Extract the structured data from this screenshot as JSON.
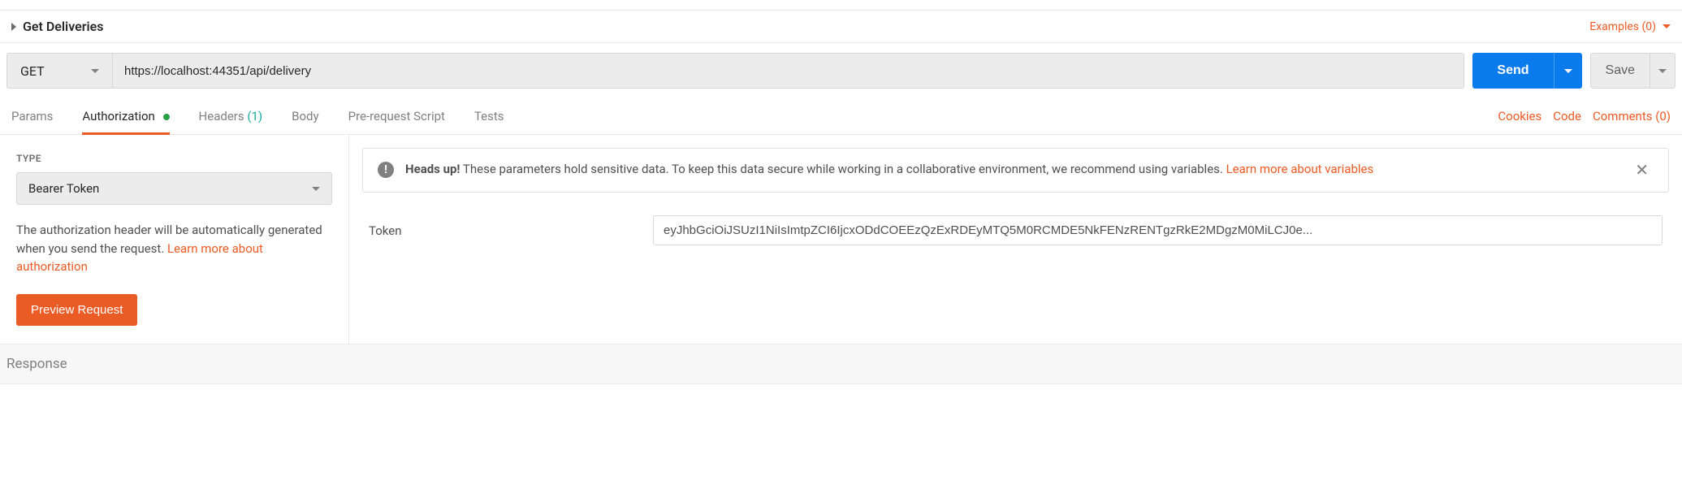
{
  "request": {
    "name": "Get Deliveries",
    "examples_label": "Examples (0)",
    "method": "GET",
    "url": "https://localhost:44351/api/delivery",
    "send_label": "Send",
    "save_label": "Save"
  },
  "tabs": {
    "params": "Params",
    "authorization": "Authorization",
    "headers": "Headers",
    "headers_count": "(1)",
    "body": "Body",
    "prerequest": "Pre-request Script",
    "tests": "Tests"
  },
  "right_links": {
    "cookies": "Cookies",
    "code": "Code",
    "comments": "Comments (0)"
  },
  "auth": {
    "type_heading": "TYPE",
    "type_value": "Bearer Token",
    "description": "The authorization header will be automatically generated when you send the request. ",
    "learn_link": "Learn more about authorization",
    "preview_label": "Preview Request"
  },
  "notice": {
    "heads_up": "Heads up!",
    "body": " These parameters hold sensitive data. To keep this data secure while working in a collaborative environment, we recommend using variables. ",
    "link": "Learn more about variables"
  },
  "token": {
    "label": "Token",
    "value": "eyJhbGciOiJSUzI1NiIsImtpZCI6IjcxODdCOEEzQzExRDEyMTQ5M0RCMDE5NkFENzRENTgzRkE2MDgzM0MiLCJ0e..."
  },
  "response": {
    "heading": "Response"
  }
}
